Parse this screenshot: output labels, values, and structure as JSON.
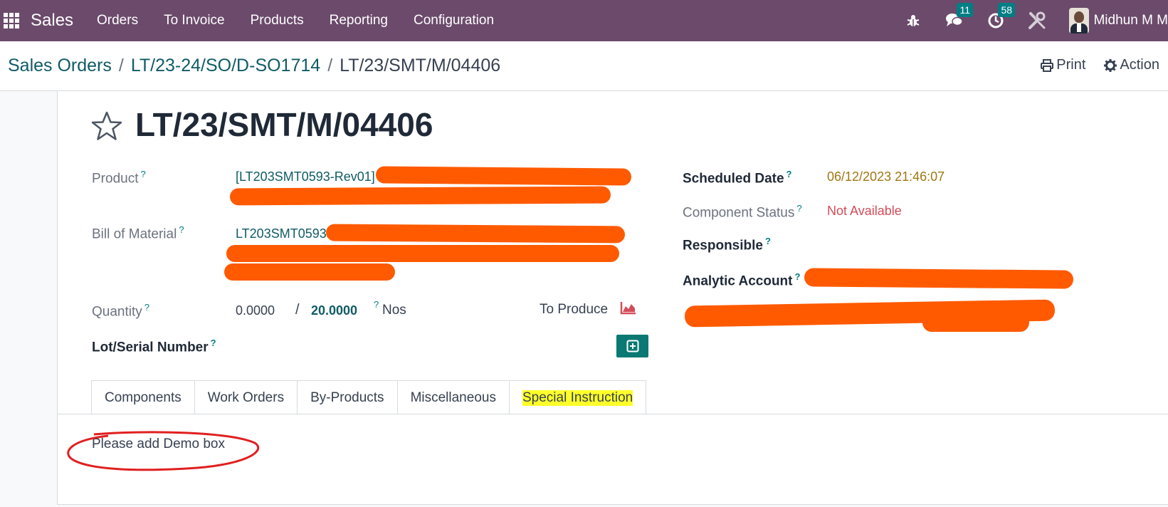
{
  "navbar": {
    "app_name": "Sales",
    "menu": [
      "Orders",
      "To Invoice",
      "Products",
      "Reporting",
      "Configuration"
    ],
    "messages_count": "11",
    "activities_count": "58",
    "user_name": "Midhun M M"
  },
  "breadcrumb": {
    "root": "Sales Orders",
    "parent": "LT/23-24/SO/D-SO1714",
    "sep": "/",
    "current": "LT/23/SMT/M/04406"
  },
  "actions": {
    "print": "Print",
    "action": "Action"
  },
  "record": {
    "title": "LT/23/SMT/M/04406",
    "left_fields": {
      "product_label": "Product",
      "product_value": "[LT203SMT0593-Rev01]",
      "bom_label": "Bill of Material",
      "bom_value": "LT203SMT0593",
      "quantity_label": "Quantity",
      "qty_produced": "0.0000",
      "qty_sep": "/",
      "qty_to_produce": "20.0000",
      "uom": "Nos",
      "to_produce_label": "To Produce",
      "lot_label": "Lot/Serial Number"
    },
    "right_fields": {
      "scheduled_date_label": "Scheduled Date",
      "scheduled_date_value": "06/12/2023 21:46:07",
      "component_status_label": "Component Status",
      "component_status_value": "Not Available",
      "responsible_label": "Responsible",
      "analytic_label": "Analytic Account"
    },
    "help_mark": "?"
  },
  "tabs": [
    "Components",
    "Work Orders",
    "By-Products",
    "Miscellaneous",
    "Special Instruction"
  ],
  "active_tab": "Special Instruction",
  "special_instruction_text": "Please add Demo box",
  "colors": {
    "navbar": "#6b4a6b",
    "link": "#0f5b66",
    "primary": "#017e84",
    "highlight": "#ffff2a",
    "redaction": "#ff5a00",
    "annotation": "#e02020"
  }
}
